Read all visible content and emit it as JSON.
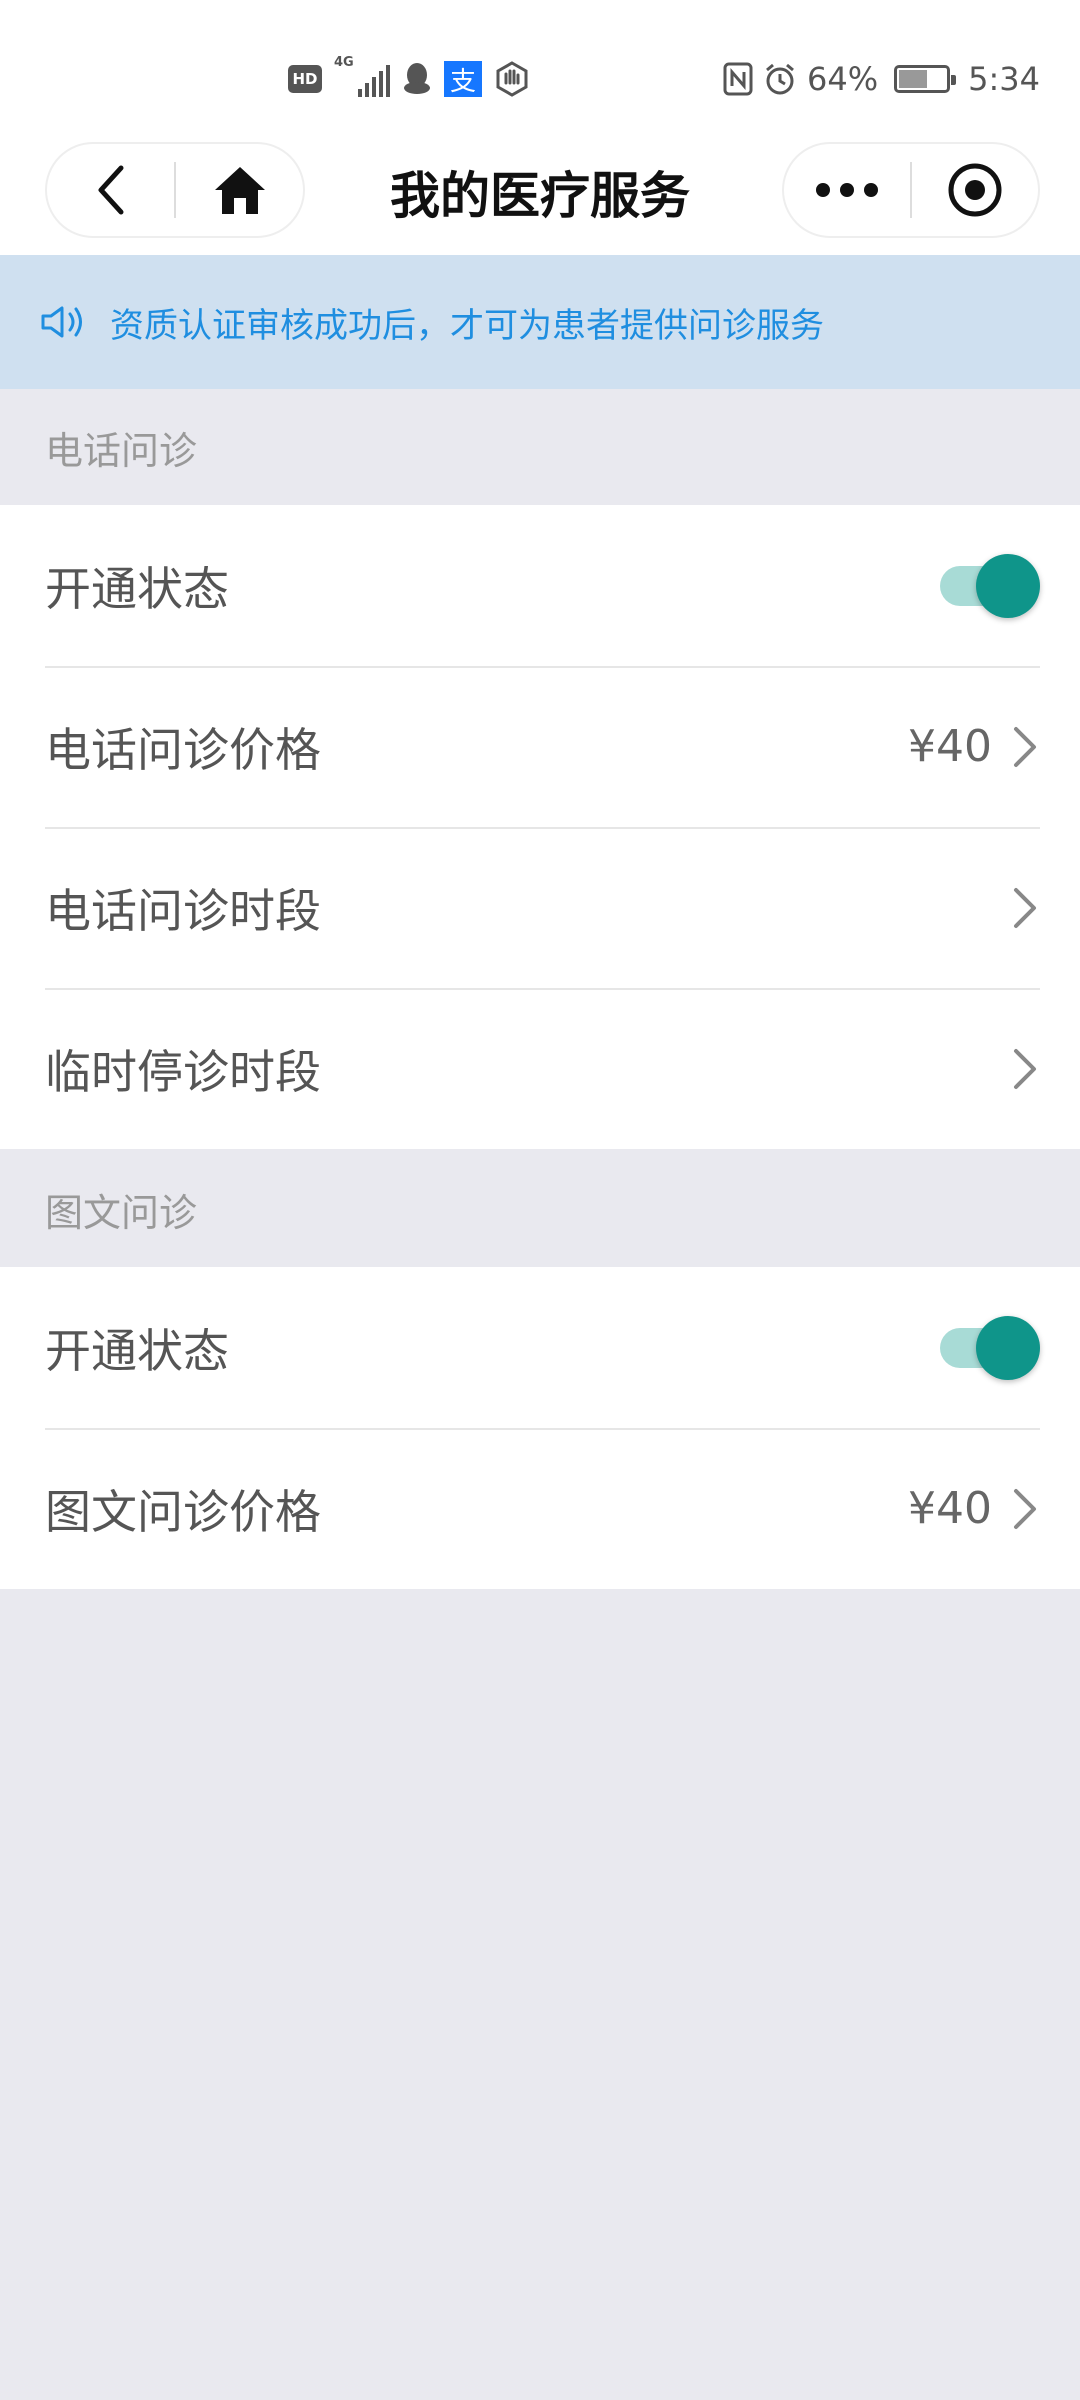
{
  "status_bar": {
    "net_tag": "4G",
    "alipay_glyph": "支",
    "hd_label": "HD",
    "battery_percent": "64%",
    "time": "5:34",
    "icons": [
      "hd-icon",
      "signal-icon",
      "qq-icon",
      "alipay-icon",
      "hand-icon",
      "nfc-icon",
      "alarm-icon",
      "battery-icon"
    ]
  },
  "nav": {
    "title": "我的医疗服务",
    "icons": [
      "back-icon",
      "home-icon",
      "more-icon",
      "target-icon"
    ]
  },
  "notice": {
    "text": "资质认证审核成功后，才可为患者提供问诊服务",
    "icon": "speaker-icon"
  },
  "phone_section": {
    "header": "电话问诊",
    "rows": [
      {
        "label": "开通状态",
        "toggle_on": true
      },
      {
        "label": "电话问诊价格",
        "value": "¥40"
      },
      {
        "label": "电话问诊时段"
      },
      {
        "label": "临时停诊时段"
      }
    ]
  },
  "text_section": {
    "header": "图文问诊",
    "rows": [
      {
        "label": "开通状态",
        "toggle_on": true
      },
      {
        "label": "图文问诊价格",
        "value": "¥40"
      }
    ]
  },
  "colors": {
    "notice_bg": "#cfe0f0",
    "notice_text": "#1f8ee0",
    "toggle_knob": "#0f958a",
    "toggle_track": "#a8dbd6",
    "page_bg": "#e9e9ef"
  }
}
